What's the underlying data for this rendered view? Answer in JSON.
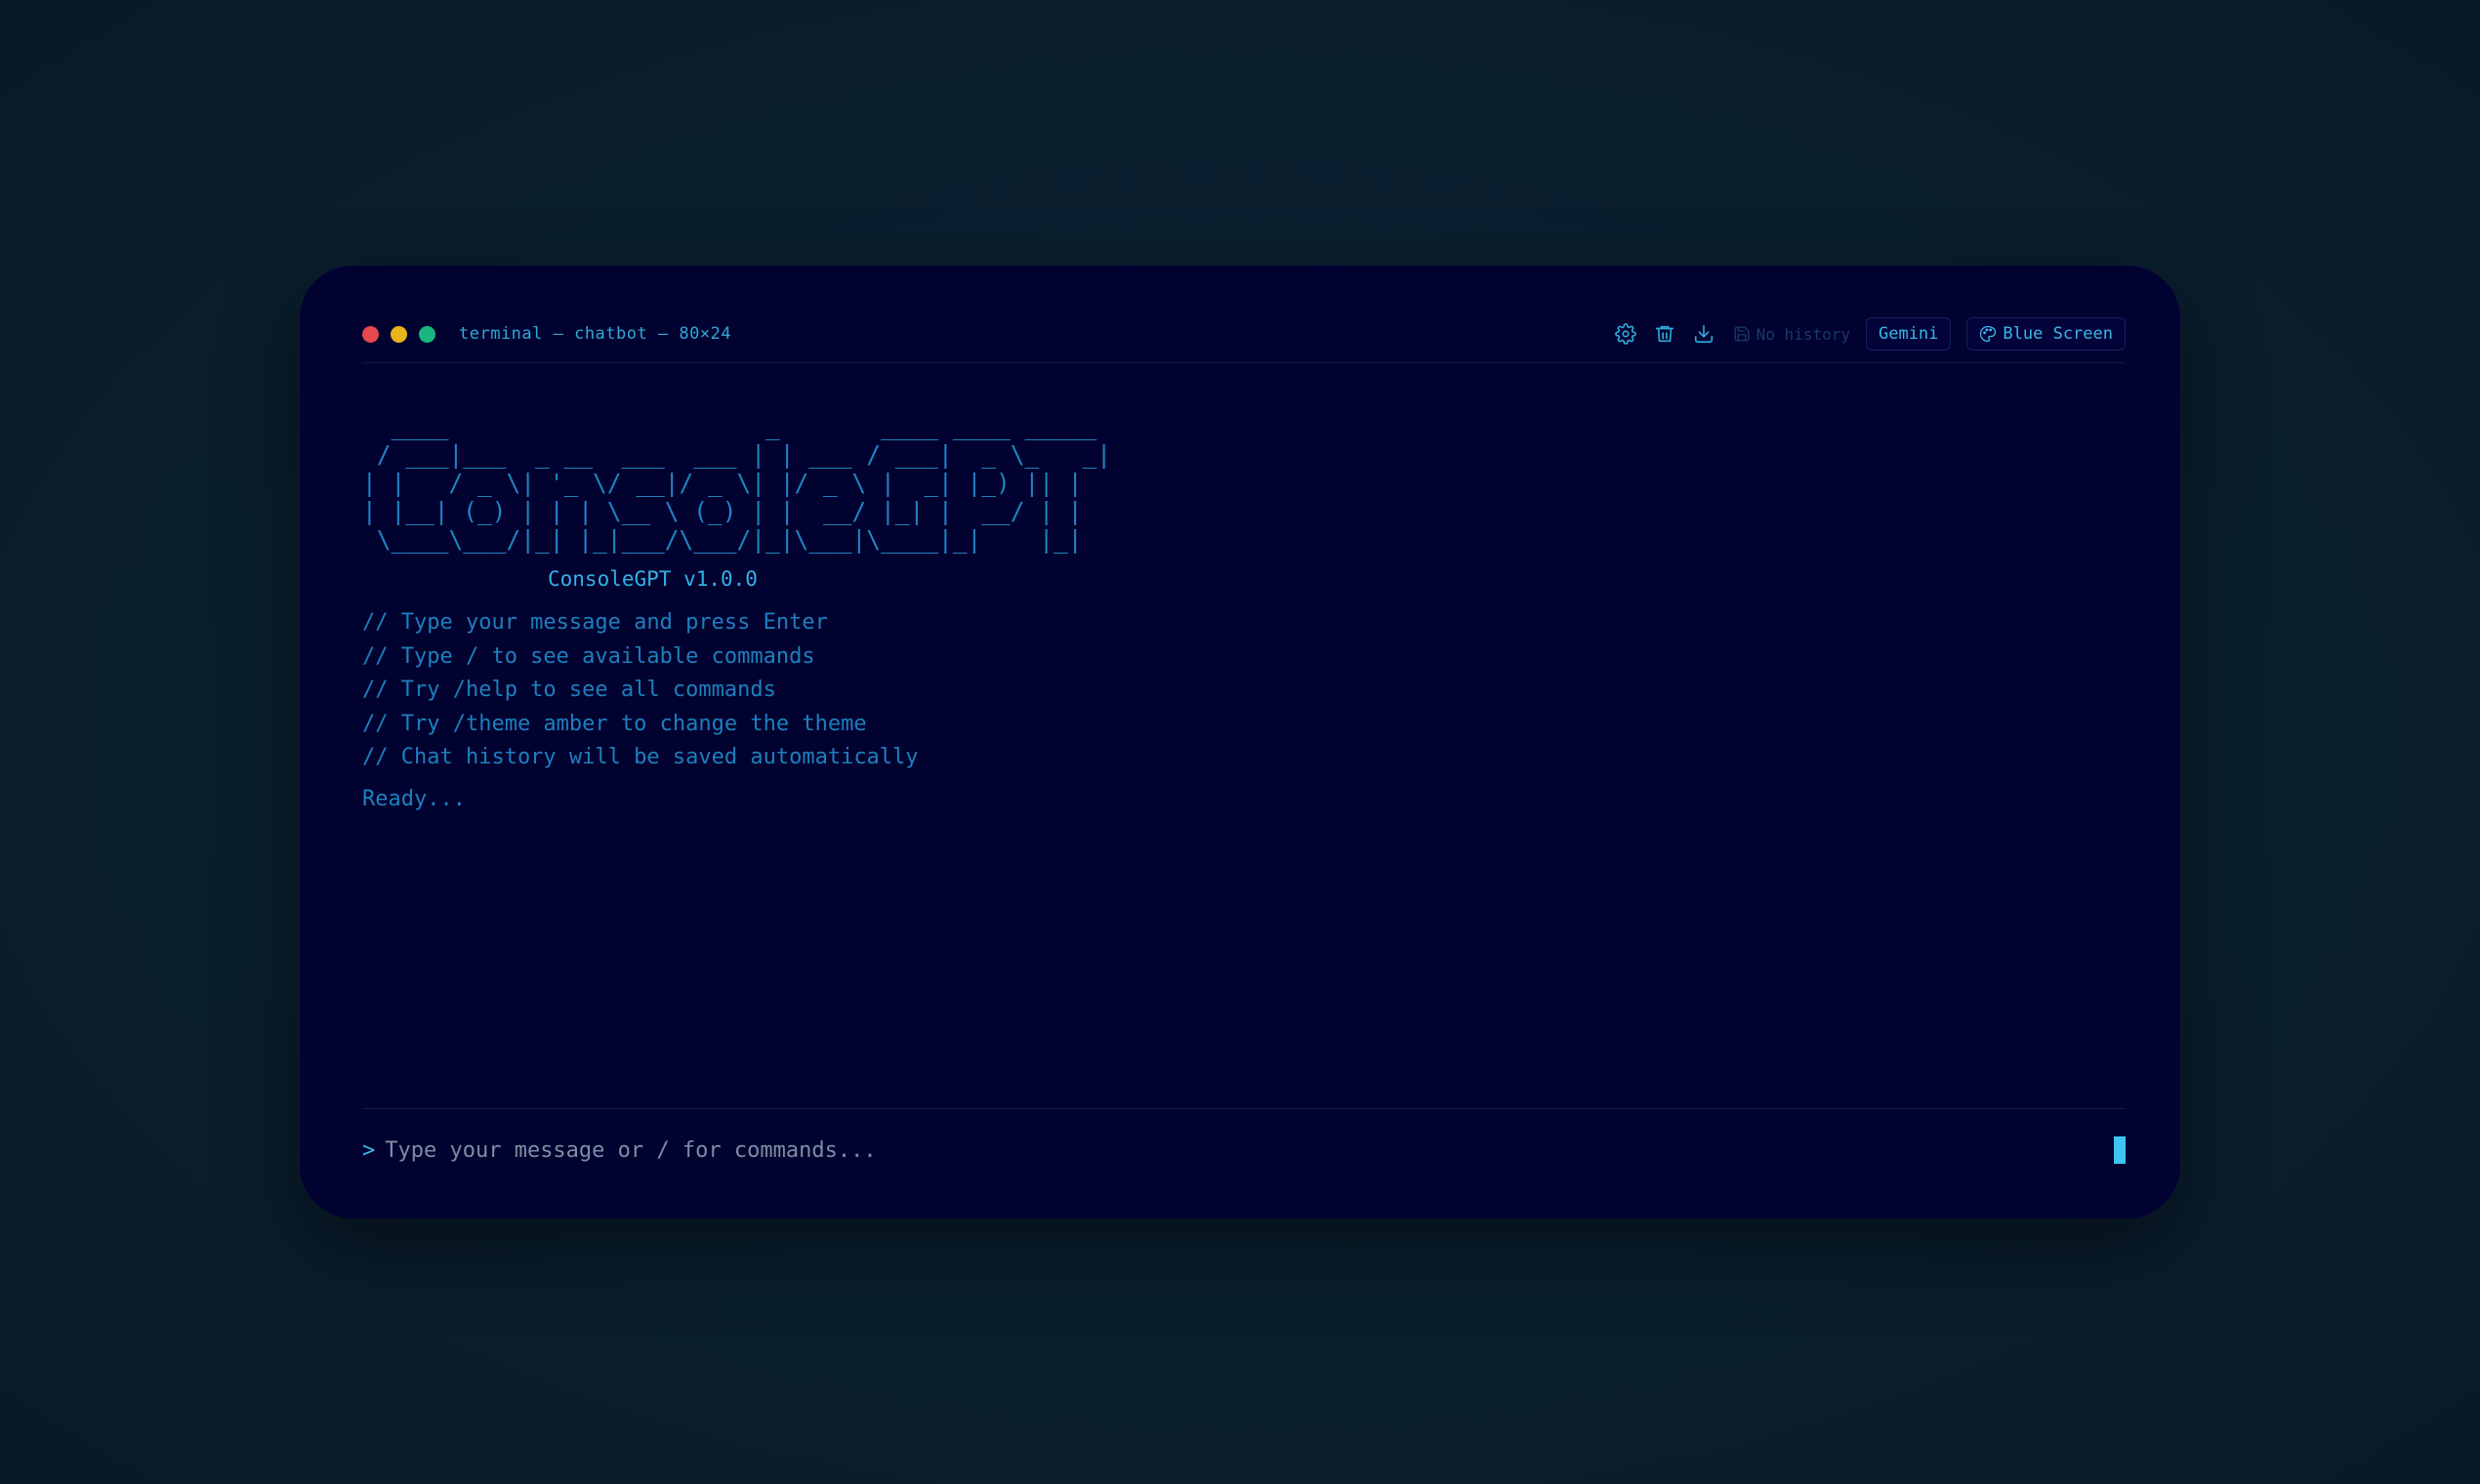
{
  "window": {
    "title": "terminal — chatbot — 80×24",
    "controls": [
      "close",
      "minimize",
      "maximize"
    ]
  },
  "toolbar": {
    "icons": [
      "gear-icon",
      "trash-icon",
      "download-icon",
      "save-icon",
      "palette-icon"
    ],
    "history_status": "No history",
    "model_label": "Gemini",
    "theme_label": "Blue Screen"
  },
  "banner": {
    "ascii_lines": [
      "  ____                      _       ____ ____ _____",
      " / ___|___  _ __  ___  ___ | | ___ / ___|  _ \\_   _|",
      "| |   / _ \\| '_ \\/ __|/ _ \\| |/ _ \\ |  _| |_) || |",
      "| |__| (_) | | | \\__ \\ (_) | |  __/ |_| |  __/ | |",
      " \\____\\___/|_| |_|___/\\___/|_|\\___|\\____|_|    |_|"
    ],
    "version": "ConsoleGPT v1.0.0"
  },
  "intro": {
    "lines": [
      "// Type your message and press Enter",
      "// Type / to see available commands",
      "// Try /help to see all commands",
      "// Try /theme amber to change the theme",
      "// Chat history will be saved automatically"
    ],
    "status": "Ready..."
  },
  "input": {
    "prompt": ">",
    "placeholder": "Type your message or / for commands...",
    "value": ""
  },
  "colors": {
    "page_background": "#0a2030",
    "terminal_background": "#020230",
    "accent": "#38b8e8",
    "text": "#1d7fbe",
    "close": "#e5484d",
    "minimize": "#e9b31a",
    "maximize": "#19b77f"
  }
}
